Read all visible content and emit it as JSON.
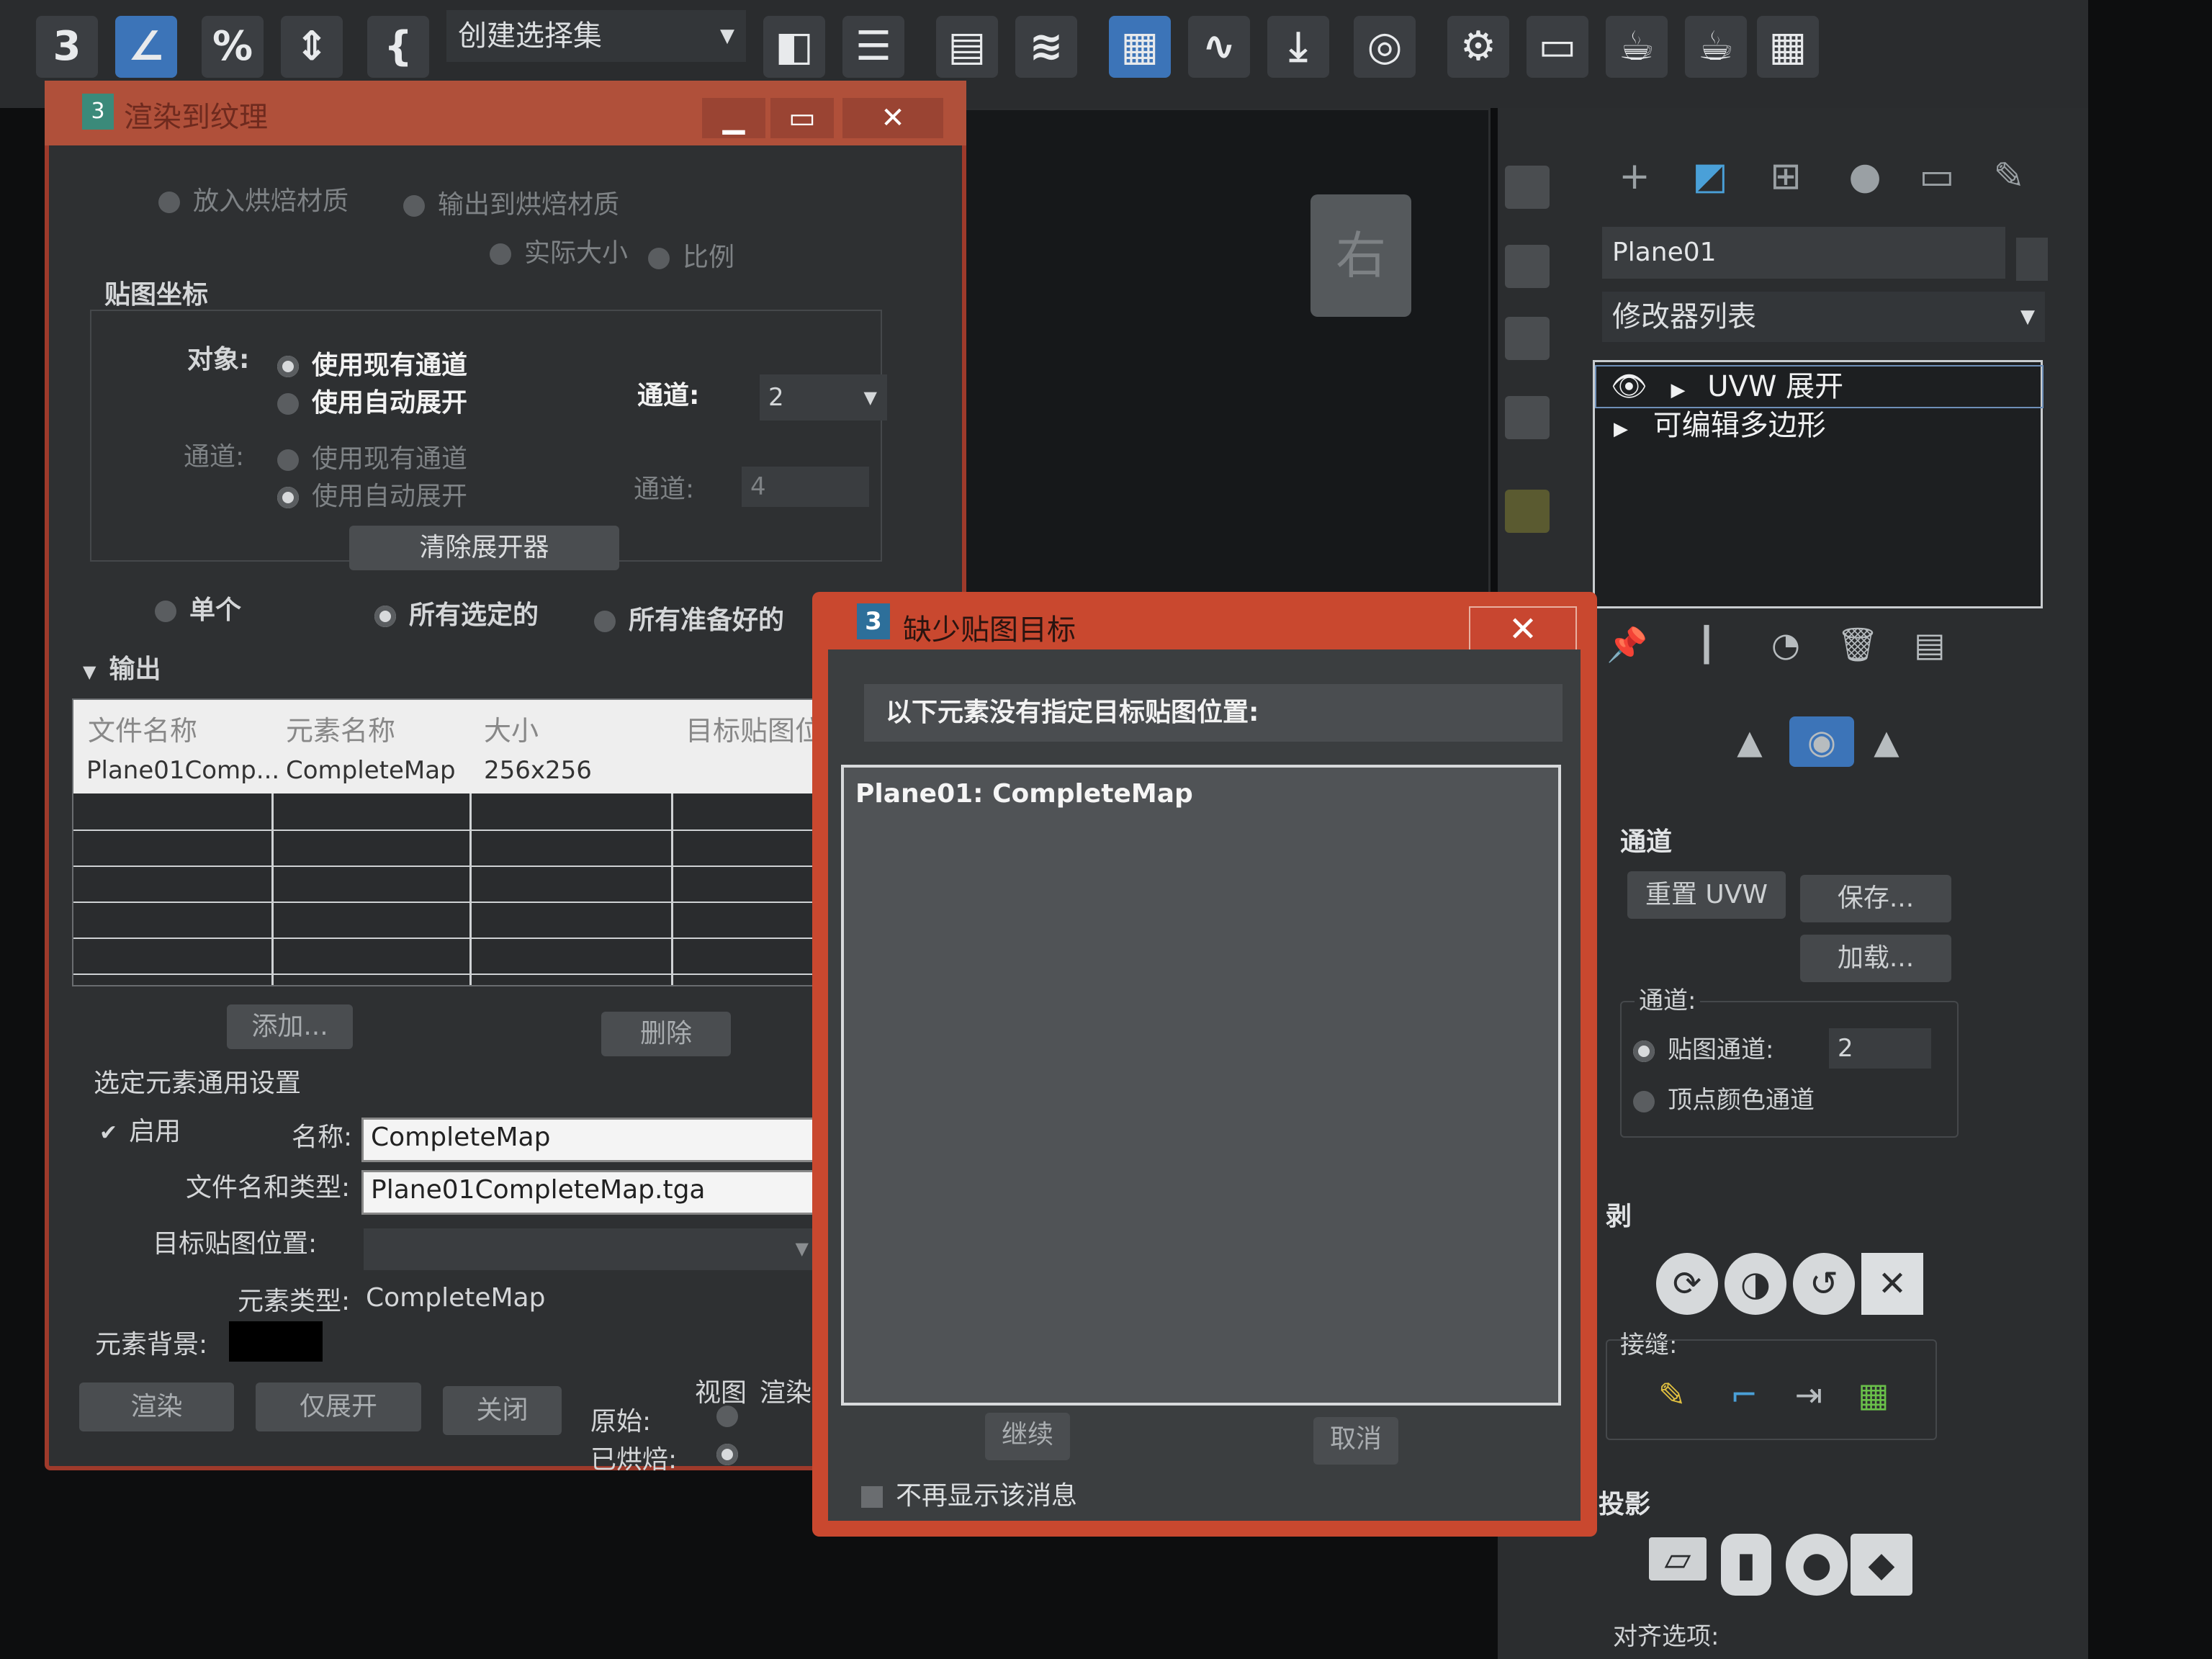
{
  "toolbar": {
    "selection_set": "创建选择集",
    "icons": [
      "snap-toggle-icon",
      "angle-snap-icon",
      "percent-snap-icon",
      "spinner-snap-icon",
      "edit-named-selection-icon",
      "mirror-icon",
      "align-icon",
      "layer-explorer-icon",
      "layer-icon",
      "scene-explorer-icon",
      "curve-editor-icon",
      "schematic-view-icon",
      "material-editor-icon",
      "render-setup-icon",
      "rendered-frame-icon",
      "render-icon",
      "render-iterative-icon",
      "render-cloud-icon"
    ]
  },
  "viewport": {
    "viewcube_label": "右"
  },
  "command_panel": {
    "object_name": "Plane01",
    "modifier_list": "修改器列表",
    "stack": [
      "UVW 展开",
      "可编辑多边形"
    ],
    "channel_section": "通道",
    "reset_uvw": "重置 UVW",
    "save": "保存...",
    "load": "加载...",
    "channel_label": "通道:",
    "map_channel_label": "贴图通道:",
    "map_channel_value": "2",
    "vertex_color_label": "顶点颜色通道",
    "peel_section": "剥",
    "seams_label": "接缝:",
    "projection_section": "投影",
    "align_options_label": "对齐选项:"
  },
  "rtt": {
    "title": "渲染到纹理",
    "bake_top_radio1": "放入烘焙材质",
    "bake_top_radio2": "输出到烘焙材质",
    "actual_size": "实际大小",
    "ratio": "比例",
    "mapping_coords": "贴图坐标",
    "object_label": "对象:",
    "use_existing_channel": "使用现有通道",
    "use_auto_unwrap": "使用自动展开",
    "channel_label": "通道:",
    "channel_value": "2",
    "sub_object_label": "通道:",
    "sub_use_existing": "使用现有通道",
    "sub_use_auto": "使用自动展开",
    "sub_channel_label": "通道:",
    "sub_channel_value": "4",
    "clear_unwrapper": "清除展开器",
    "single": "单个",
    "all_selected": "所有选定的",
    "all_prepared": "所有准备好的",
    "output_section": "输出",
    "output_headers": [
      "文件名称",
      "元素名称",
      "大小",
      "目标贴图位"
    ],
    "output_row": [
      "Plane01Comp...",
      "CompleteMap",
      "256x256",
      ""
    ],
    "add": "添加...",
    "delete": "删除",
    "selected_element_settings": "选定元素通用设置",
    "enable": "启用",
    "name_label": "名称:",
    "name_value": "CompleteMap",
    "file_label": "文件名和类型:",
    "file_value": "Plane01CompleteMap.tga",
    "target_label": "目标贴图位置:",
    "element_type_label": "元素类型:",
    "element_type_value": "CompleteMap",
    "element_bg_label": "元素背景:",
    "render": "渲染",
    "unwrap_only": "仅展开",
    "close": "关闭",
    "view_label": "视图",
    "render_label": "渲染",
    "original_label": "原始:",
    "baked_label": "已烘焙:"
  },
  "dialog": {
    "title": "缺少贴图目标",
    "message": "以下元素没有指定目标贴图位置:",
    "items": [
      "Plane01: CompleteMap"
    ],
    "continue": "继续",
    "cancel": "取消",
    "dont_show": "不再显示该消息"
  },
  "colors": {
    "accent_red": "#c9482f",
    "panel": "#2b2d2f",
    "active_blue": "#3c74b8"
  }
}
